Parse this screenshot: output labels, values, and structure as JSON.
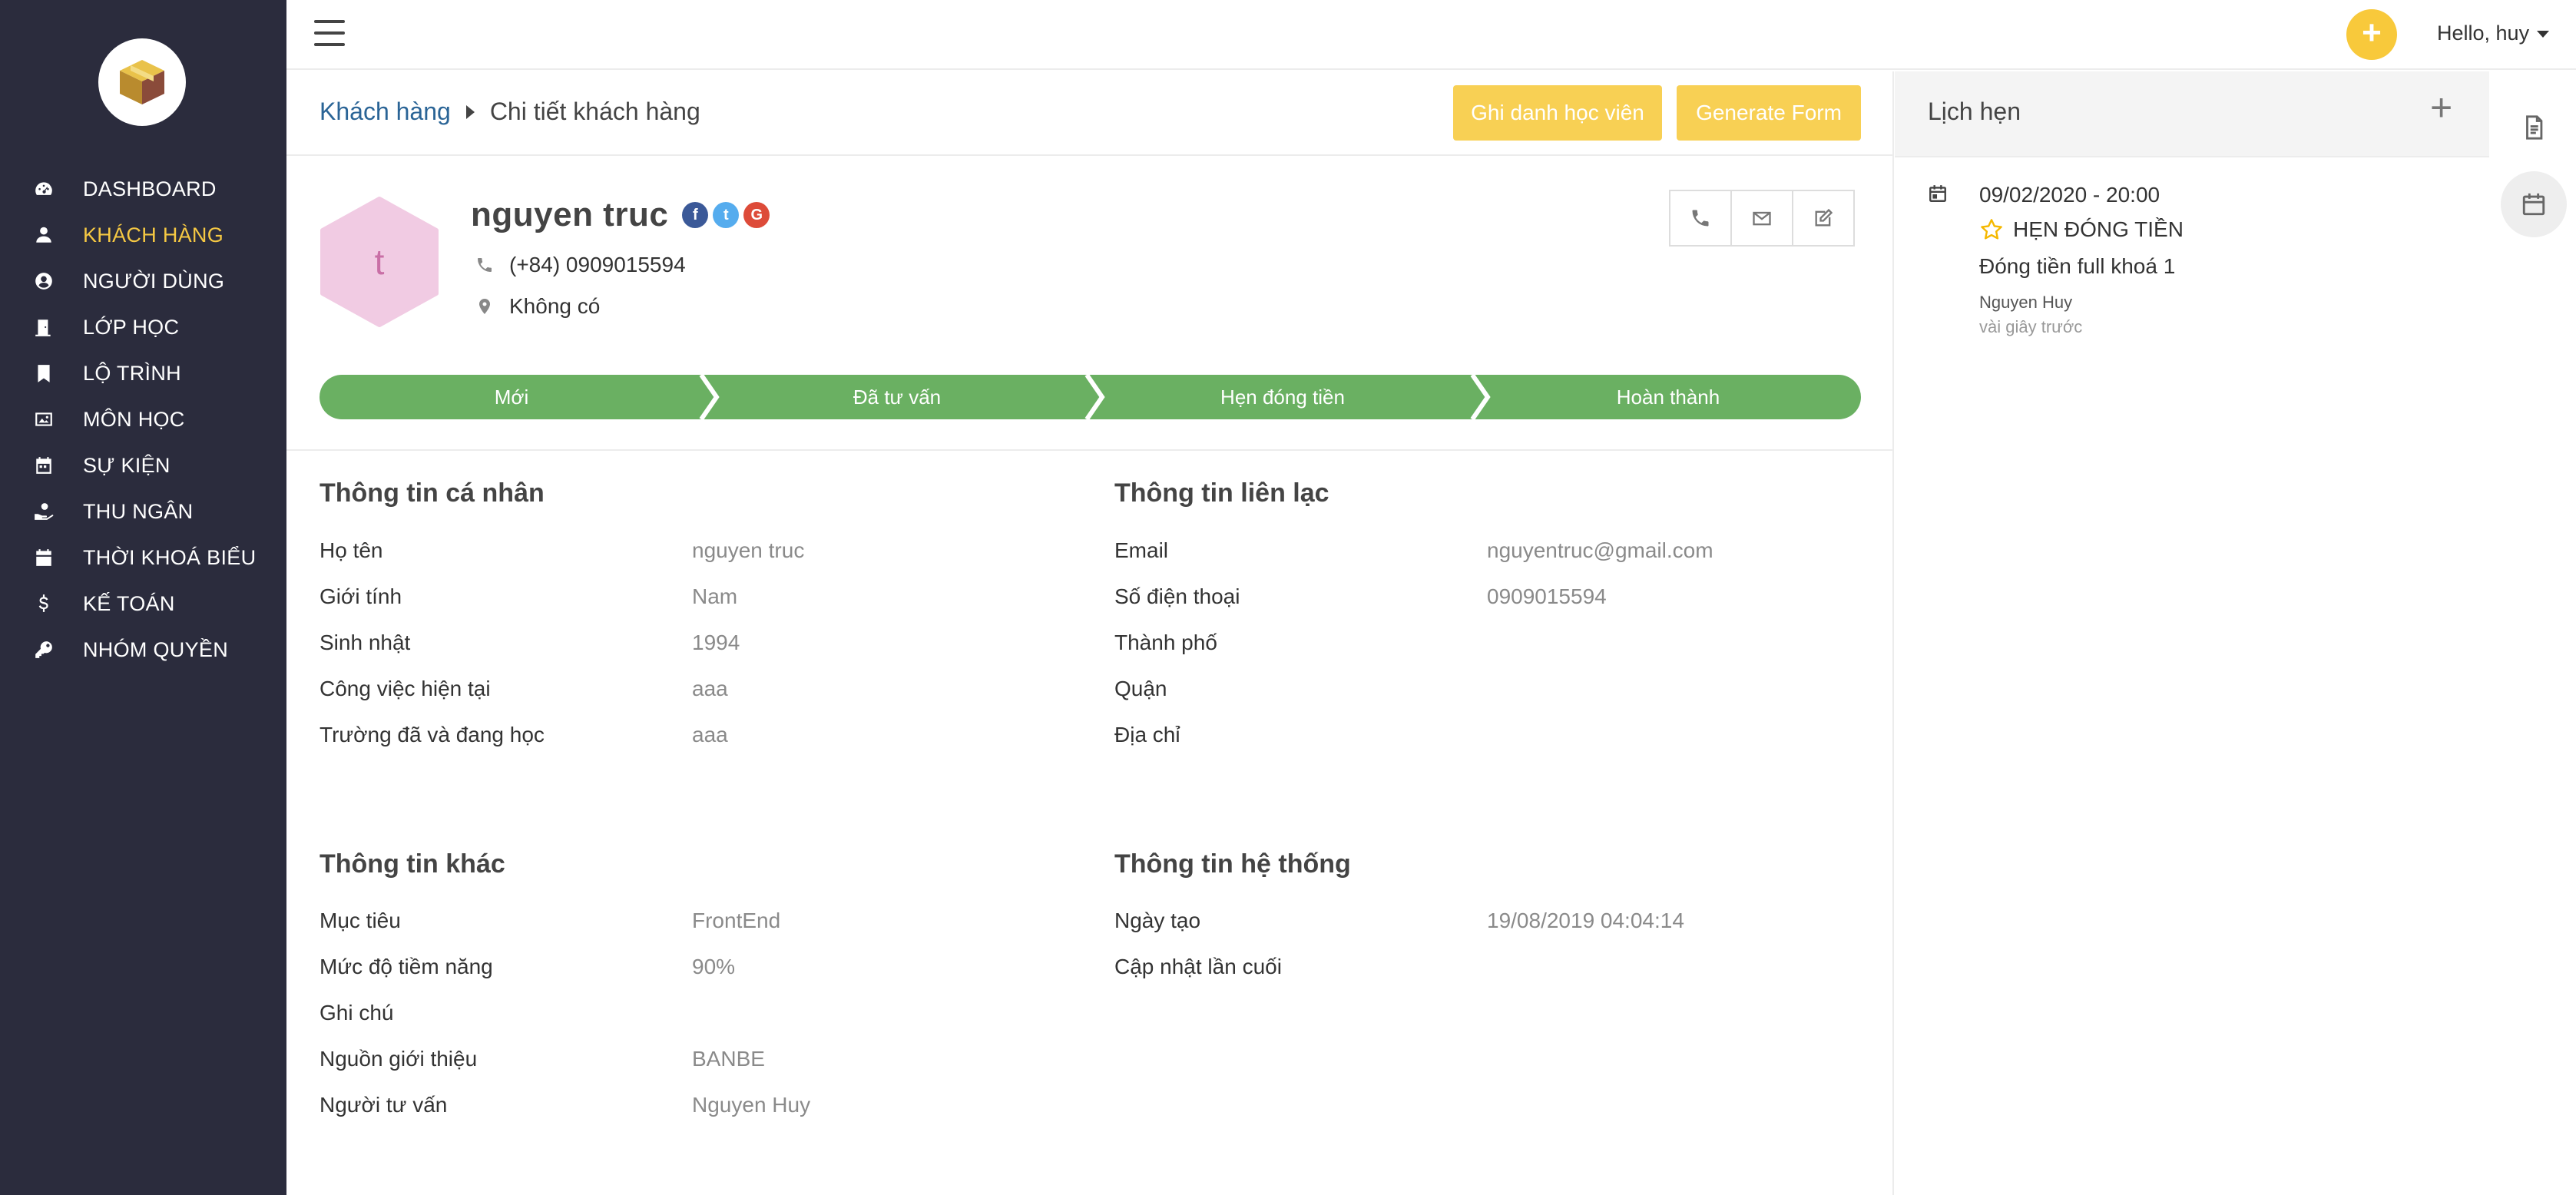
{
  "sidebar": {
    "items": [
      {
        "label": "DASHBOARD",
        "icon": "dashboard-icon",
        "active": false
      },
      {
        "label": "KHÁCH HÀNG",
        "icon": "user-icon",
        "active": true
      },
      {
        "label": "NGƯỜI DÙNG",
        "icon": "user-circle-icon",
        "active": false
      },
      {
        "label": "LỚP HỌC",
        "icon": "door-icon",
        "active": false
      },
      {
        "label": "LỘ TRÌNH",
        "icon": "bookmark-icon",
        "active": false
      },
      {
        "label": "MÔN HỌC",
        "icon": "image-icon",
        "active": false
      },
      {
        "label": "SỰ KIỆN",
        "icon": "calendar-icon",
        "active": false
      },
      {
        "label": "THU NGÂN",
        "icon": "hand-coin-icon",
        "active": false
      },
      {
        "label": "THỜI KHOÁ BIỂU",
        "icon": "calendar-solid-icon",
        "active": false
      },
      {
        "label": "KẾ TOÁN",
        "icon": "dollar-icon",
        "active": false
      },
      {
        "label": "NHÓM QUYỀN",
        "icon": "key-icon",
        "active": false
      }
    ]
  },
  "topbar": {
    "greeting": "Hello, huy",
    "add_symbol": "+"
  },
  "breadcrumb": {
    "parent": "Khách hàng",
    "current": "Chi tiết khách hàng"
  },
  "actions": {
    "enroll_label": "Ghi danh học viên",
    "generate_label": "Generate Form"
  },
  "customer": {
    "avatar_letter": "t",
    "name": "nguyen truc",
    "phone": "(+84) 0909015594",
    "address": "Không có",
    "social": {
      "facebook": "f",
      "twitter": "t",
      "google": "G"
    }
  },
  "pipeline": {
    "stages": [
      "Mới",
      "Đã tư vấn",
      "Hẹn đóng tiền",
      "Hoàn thành"
    ],
    "color": "#6ab062"
  },
  "personal": {
    "title": "Thông tin cá nhân",
    "fields": [
      {
        "label": "Họ tên",
        "value": "nguyen truc"
      },
      {
        "label": "Giới tính",
        "value": "Nam"
      },
      {
        "label": "Sinh nhật",
        "value": "1994"
      },
      {
        "label": "Công việc hiện tại",
        "value": "aaa"
      },
      {
        "label": "Trường đã và đang học",
        "value": "aaa"
      }
    ]
  },
  "contact": {
    "title": "Thông tin liên lạc",
    "fields": [
      {
        "label": "Email",
        "value": "nguyentruc@gmail.com"
      },
      {
        "label": "Số điện thoại",
        "value": "0909015594"
      },
      {
        "label": "Thành phố",
        "value": ""
      },
      {
        "label": "Quận",
        "value": ""
      },
      {
        "label": "Địa chỉ",
        "value": ""
      }
    ]
  },
  "other": {
    "title": "Thông tin khác",
    "fields": [
      {
        "label": "Mục tiêu",
        "value": "FrontEnd"
      },
      {
        "label": "Mức độ tiềm năng",
        "value": "90%"
      },
      {
        "label": "Ghi chú",
        "value": ""
      },
      {
        "label": "Nguồn giới thiệu",
        "value": "BANBE"
      },
      {
        "label": "Người tư vấn",
        "value": "Nguyen Huy"
      }
    ]
  },
  "system": {
    "title": "Thông tin hệ thống",
    "fields": [
      {
        "label": "Ngày tạo",
        "value": "19/08/2019 04:04:14"
      },
      {
        "label": "Cập nhật lần cuối",
        "value": ""
      }
    ]
  },
  "appointments": {
    "title": "Lịch hẹn",
    "add_symbol": "+",
    "items": [
      {
        "datetime": "09/02/2020 - 20:00",
        "type": "HẸN ĐÓNG TIỀN",
        "description": "Đóng tiền full khoá 1",
        "by": "Nguyen Huy",
        "ago": "vài giây trước"
      }
    ]
  },
  "colors": {
    "sidebar_bg": "#2b2c3d",
    "accent": "#f5c843",
    "button_yellow": "#f8d054",
    "avatar_bg": "#f1cbe3"
  }
}
